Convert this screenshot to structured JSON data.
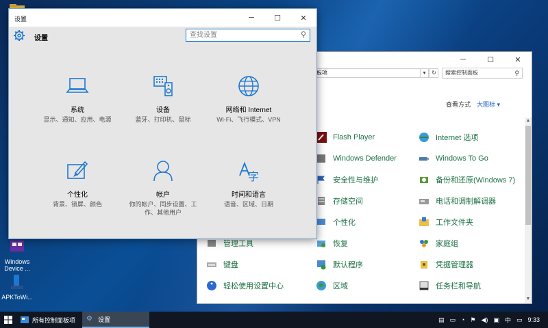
{
  "desktop": {
    "icons": [
      {
        "label": "Windows Device ..."
      },
      {
        "label": "APKToWi..."
      }
    ]
  },
  "control_panel": {
    "address": "板项",
    "search_placeholder": "搜索控制面板",
    "view_by_label": "查看方式",
    "view_by_value": "大图标 ▾",
    "items": [
      {
        "label": "Flash Player",
        "icon": "flash-icon"
      },
      {
        "label": "Internet 选项",
        "icon": "globe-gear-icon"
      },
      {
        "label": "Windows Defender",
        "icon": "defender-icon"
      },
      {
        "label": "Windows To Go",
        "icon": "usb-drive-icon"
      },
      {
        "label": "安全性与维护",
        "icon": "flag-icon"
      },
      {
        "label": "备份和还原(Windows 7)",
        "icon": "backup-icon"
      },
      {
        "label": "存储空间",
        "icon": "storage-icon"
      },
      {
        "label": "电话和调制解调器",
        "icon": "phone-modem-icon"
      },
      {
        "label": "个性化",
        "icon": "personalize-icon"
      },
      {
        "label": "工作文件夹",
        "icon": "work-folder-icon"
      },
      {
        "label": "管理工具",
        "icon": "admin-tools-icon"
      },
      {
        "label": "恢复",
        "icon": "recovery-icon"
      },
      {
        "label": "家庭组",
        "icon": "homegroup-icon"
      },
      {
        "label": "键盘",
        "icon": "keyboard-icon"
      },
      {
        "label": "默认程序",
        "icon": "default-programs-icon"
      },
      {
        "label": "凭据管理器",
        "icon": "credential-icon"
      },
      {
        "label": "轻松使用设置中心",
        "icon": "ease-of-access-icon"
      },
      {
        "label": "区域",
        "icon": "region-icon"
      },
      {
        "label": "任务栏和导航",
        "icon": "taskbar-icon"
      }
    ]
  },
  "settings": {
    "window_title": "设置",
    "header_title": "设置",
    "search_placeholder": "查找设置",
    "tiles": [
      {
        "name": "系统",
        "desc": "显示、通知、应用、电源",
        "icon": "laptop-icon"
      },
      {
        "name": "设备",
        "desc": "蓝牙、打印机、鼠标",
        "icon": "devices-icon"
      },
      {
        "name": "网络和 Internet",
        "desc": "Wi-Fi、飞行模式、VPN",
        "icon": "globe-icon"
      },
      {
        "name": "个性化",
        "desc": "背景、锁屏、颜色",
        "icon": "paint-icon"
      },
      {
        "name": "帐户",
        "desc": "你的帐户、同步设置、工作、其他用户",
        "icon": "person-icon"
      },
      {
        "name": "时间和语言",
        "desc": "语音、区域、日期",
        "icon": "time-language-icon"
      }
    ]
  },
  "taskbar": {
    "apps": [
      {
        "label": "所有控制面板项"
      },
      {
        "label": "设置"
      }
    ],
    "ime": "中",
    "time": "9:33"
  },
  "colors": {
    "accent": "#1e78d2",
    "cp_link": "#1e7145",
    "taskbar": "#101722"
  }
}
